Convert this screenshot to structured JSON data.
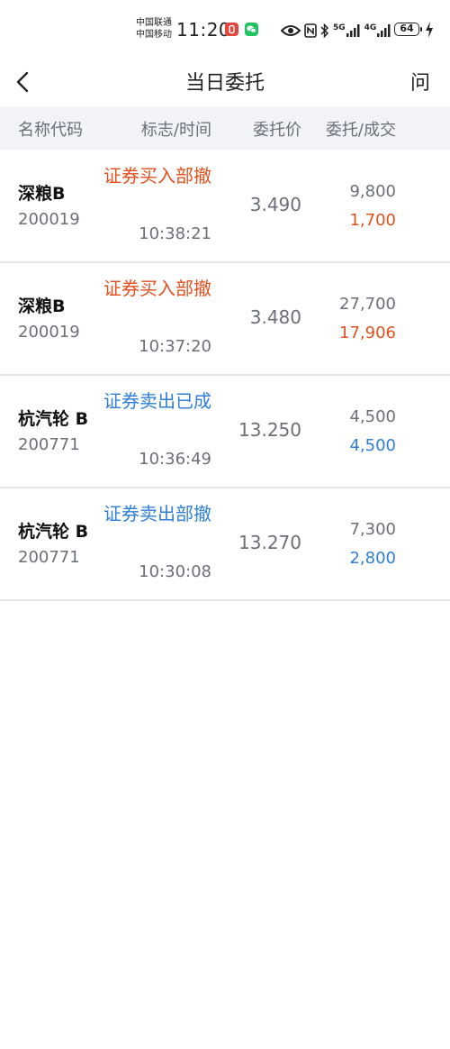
{
  "status_bar": {
    "carrier1": "中国联通",
    "carrier2": "中国移动",
    "time": "11:20",
    "network1": "5G",
    "network2": "4G",
    "battery": "64"
  },
  "nav": {
    "title": "当日委托",
    "help_label": "问"
  },
  "table": {
    "headers": {
      "name": "名称代码",
      "flag": "标志/时间",
      "price": "委托价",
      "qty": "委托/成交"
    },
    "rows": [
      {
        "name": "深粮B",
        "code": "200019",
        "flag": "证券买入部撤",
        "side": "buy",
        "time": "10:38:21",
        "price": "3.490",
        "ordered": "9,800",
        "filled": "1,700"
      },
      {
        "name": "深粮B",
        "code": "200019",
        "flag": "证券买入部撤",
        "side": "buy",
        "time": "10:37:20",
        "price": "3.480",
        "ordered": "27,700",
        "filled": "17,906"
      },
      {
        "name": "杭汽轮 B",
        "code": "200771",
        "flag": "证券卖出已成",
        "side": "sell",
        "time": "10:36:49",
        "price": "13.250",
        "ordered": "4,500",
        "filled": "4,500"
      },
      {
        "name": "杭汽轮 B",
        "code": "200771",
        "flag": "证券卖出部撤",
        "side": "sell",
        "time": "10:30:08",
        "price": "13.270",
        "ordered": "7,300",
        "filled": "2,800"
      }
    ]
  },
  "colors": {
    "buy": "#e2501d",
    "sell": "#2f7fd6",
    "header_bg": "#f1f3f7"
  }
}
